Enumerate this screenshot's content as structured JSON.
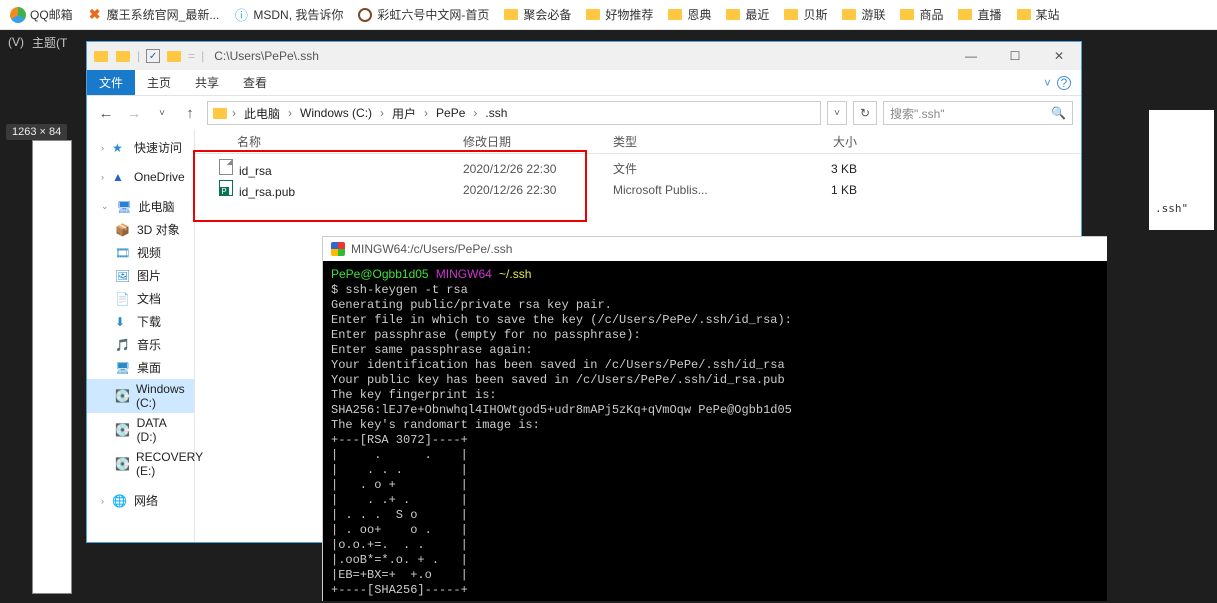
{
  "bookmarks": [
    {
      "label": "QQ邮箱",
      "icon": "qq"
    },
    {
      "label": "魔王系统官网_最新...",
      "icon": "x"
    },
    {
      "label": "MSDN, 我告诉你",
      "icon": "m"
    },
    {
      "label": "彩虹六号中文网-首页",
      "icon": "b"
    },
    {
      "label": "聚会必备",
      "icon": "folder"
    },
    {
      "label": "好物推荐",
      "icon": "folder"
    },
    {
      "label": "恩典",
      "icon": "folder"
    },
    {
      "label": "最近",
      "icon": "folder"
    },
    {
      "label": "贝斯",
      "icon": "folder"
    },
    {
      "label": "游联",
      "icon": "folder"
    },
    {
      "label": "商品",
      "icon": "folder"
    },
    {
      "label": "直播",
      "icon": "folder"
    },
    {
      "label": "某站",
      "icon": "folder"
    }
  ],
  "darkmenu": {
    "v": "(V)",
    "s": "主题(T"
  },
  "imgsize": "1263 × 84",
  "rsnip_text": ".ssh\"",
  "explorer": {
    "titlepath": "C:\\Users\\PePe\\.ssh",
    "tabs": {
      "file": "文件",
      "home": "主页",
      "share": "共享",
      "view": "查看"
    },
    "breadcrumb": [
      "此电脑",
      "Windows (C:)",
      "用户",
      "PePe",
      ".ssh"
    ],
    "refresh_tip": "刷新",
    "search_ph": "搜索\".ssh\"",
    "columns": {
      "name": "名称",
      "date": "修改日期",
      "type": "类型",
      "size": "大小"
    },
    "files": [
      {
        "name": "id_rsa",
        "date": "2020/12/26 22:30",
        "type": "文件",
        "size": "3 KB",
        "ico": "plain"
      },
      {
        "name": "id_rsa.pub",
        "date": "2020/12/26 22:30",
        "type": "Microsoft Publis...",
        "size": "1 KB",
        "ico": "pub"
      }
    ],
    "nav": {
      "quick": "快速访问",
      "onedrive": "OneDrive",
      "pc": "此电脑",
      "sub": [
        "3D 对象",
        "视频",
        "图片",
        "文档",
        "下载",
        "音乐",
        "桌面",
        "Windows (C:)",
        "DATA (D:)",
        "RECOVERY (E:)"
      ],
      "net": "网络"
    }
  },
  "terminal": {
    "title": "MINGW64:/c/Users/PePe/.ssh",
    "prompt": {
      "user": "PePe@Ogbb1d05",
      "env": "MINGW64",
      "path": "~/.ssh"
    },
    "lines": [
      "$ ssh-keygen -t rsa",
      "Generating public/private rsa key pair.",
      "Enter file in which to save the key (/c/Users/PePe/.ssh/id_rsa):",
      "Enter passphrase (empty for no passphrase):",
      "Enter same passphrase again:",
      "Your identification has been saved in /c/Users/PePe/.ssh/id_rsa",
      "Your public key has been saved in /c/Users/PePe/.ssh/id_rsa.pub",
      "The key fingerprint is:",
      "SHA256:lEJ7e+Obnwhql4IHOWtgod5+udr8mAPj5zKq+qVmOqw PePe@Ogbb1d05",
      "The key's randomart image is:",
      "+---[RSA 3072]----+",
      "|     .      .    |",
      "|    . . .        |",
      "|   . o +         |",
      "|    . .+ .       |",
      "| . . .  S o      |",
      "| . oo+    o .    |",
      "|o.o.+=.  . .     |",
      "|.ooB*=*.o. + .   |",
      "|EB=+BX=+  +.o    |",
      "+----[SHA256]-----+"
    ]
  }
}
